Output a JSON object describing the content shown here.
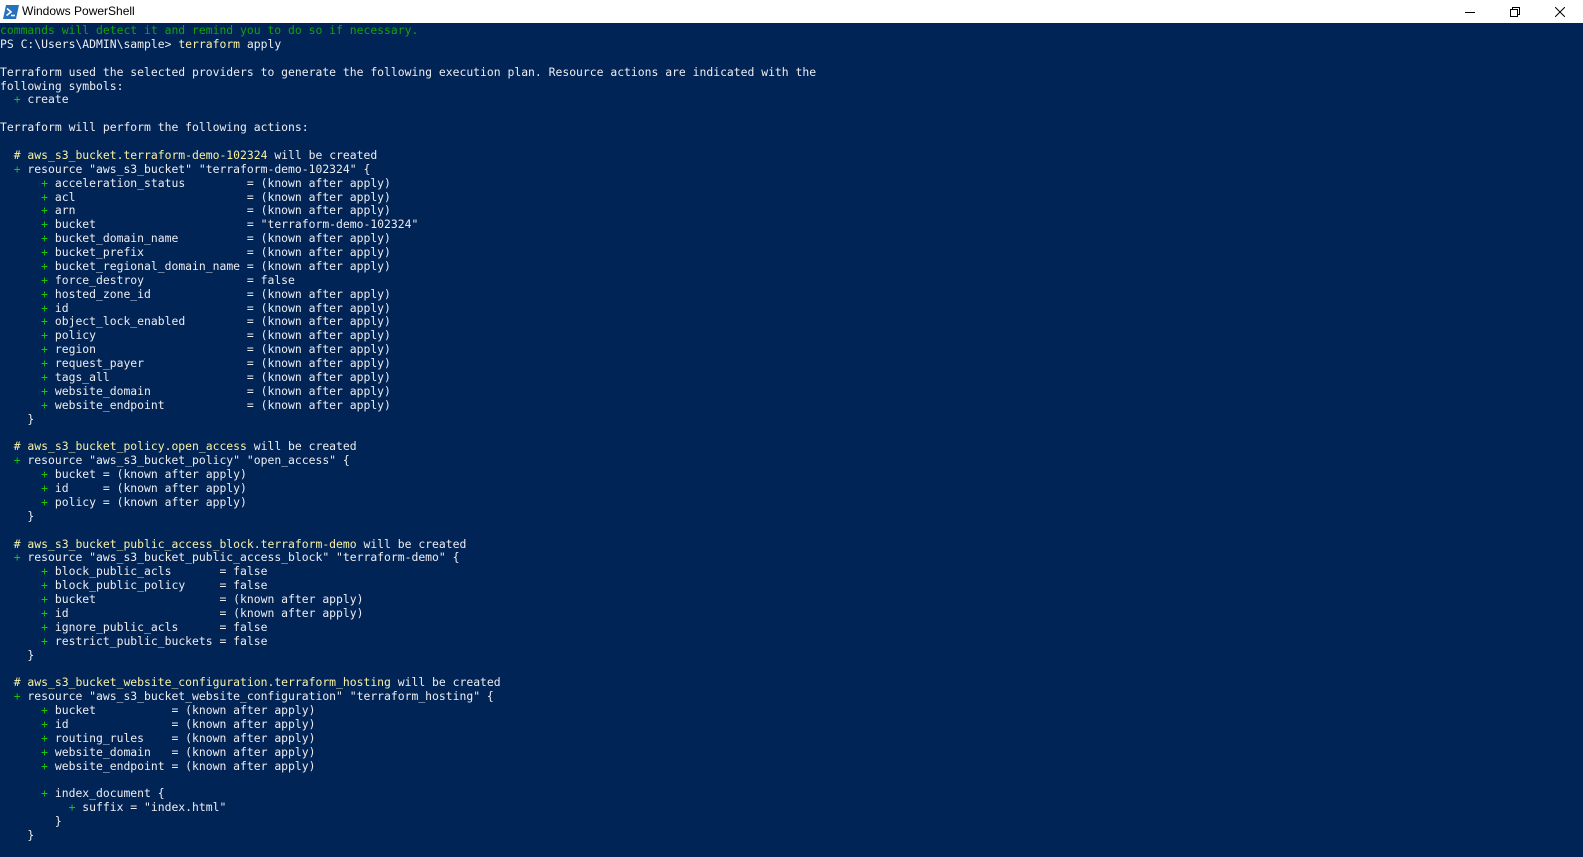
{
  "window": {
    "title": "Windows PowerShell",
    "icon": "powershell-icon",
    "controls": [
      "minimize-icon",
      "restore-icon",
      "close-icon"
    ]
  },
  "colors": {
    "background": "#012456",
    "text": "#eeedf0",
    "command": "#f9f1a5",
    "resource_header": "#f9f1a5",
    "plus": "#16c60c",
    "faded": "#13a10e"
  },
  "console": {
    "lines": [
      {
        "segments": [
          {
            "t": "commands will detect it and remind you to do so if necessary.",
            "c": "dim"
          }
        ]
      },
      {
        "segments": [
          {
            "t": "PS C:\\Users\\ADMIN\\sample> "
          },
          {
            "t": "terraform",
            "c": "yel"
          },
          {
            "t": " apply"
          }
        ]
      },
      {
        "segments": []
      },
      {
        "segments": [
          {
            "t": "Terraform used the selected providers to generate the following execution plan. Resource actions are indicated with the"
          }
        ]
      },
      {
        "segments": [
          {
            "t": "following symbols:"
          }
        ]
      },
      {
        "segments": [
          {
            "t": "  "
          },
          {
            "t": "+",
            "c": "grn"
          },
          {
            "t": " create"
          }
        ]
      },
      {
        "segments": []
      },
      {
        "segments": [
          {
            "t": "Terraform will perform the following actions:"
          }
        ]
      },
      {
        "segments": []
      },
      {
        "segments": [
          {
            "t": "  "
          },
          {
            "t": "# aws_s3_bucket.terraform-demo-102324",
            "c": "yel"
          },
          {
            "t": " will be created"
          }
        ]
      },
      {
        "segments": [
          {
            "t": "  "
          },
          {
            "t": "+",
            "c": "grn"
          },
          {
            "t": " resource \"aws_s3_bucket\" \"terraform-demo-102324\" {"
          }
        ]
      },
      {
        "segments": [
          {
            "t": "      "
          },
          {
            "t": "+",
            "c": "grn"
          },
          {
            "t": " acceleration_status         = (known after apply)"
          }
        ]
      },
      {
        "segments": [
          {
            "t": "      "
          },
          {
            "t": "+",
            "c": "grn"
          },
          {
            "t": " acl                         = (known after apply)"
          }
        ]
      },
      {
        "segments": [
          {
            "t": "      "
          },
          {
            "t": "+",
            "c": "grn"
          },
          {
            "t": " arn                         = (known after apply)"
          }
        ]
      },
      {
        "segments": [
          {
            "t": "      "
          },
          {
            "t": "+",
            "c": "grn"
          },
          {
            "t": " bucket                      = \"terraform-demo-102324\""
          }
        ]
      },
      {
        "segments": [
          {
            "t": "      "
          },
          {
            "t": "+",
            "c": "grn"
          },
          {
            "t": " bucket_domain_name          = (known after apply)"
          }
        ]
      },
      {
        "segments": [
          {
            "t": "      "
          },
          {
            "t": "+",
            "c": "grn"
          },
          {
            "t": " bucket_prefix               = (known after apply)"
          }
        ]
      },
      {
        "segments": [
          {
            "t": "      "
          },
          {
            "t": "+",
            "c": "grn"
          },
          {
            "t": " bucket_regional_domain_name = (known after apply)"
          }
        ]
      },
      {
        "segments": [
          {
            "t": "      "
          },
          {
            "t": "+",
            "c": "grn"
          },
          {
            "t": " force_destroy               = false"
          }
        ]
      },
      {
        "segments": [
          {
            "t": "      "
          },
          {
            "t": "+",
            "c": "grn"
          },
          {
            "t": " hosted_zone_id              = (known after apply)"
          }
        ]
      },
      {
        "segments": [
          {
            "t": "      "
          },
          {
            "t": "+",
            "c": "grn"
          },
          {
            "t": " id                          = (known after apply)"
          }
        ]
      },
      {
        "segments": [
          {
            "t": "      "
          },
          {
            "t": "+",
            "c": "grn"
          },
          {
            "t": " object_lock_enabled         = (known after apply)"
          }
        ]
      },
      {
        "segments": [
          {
            "t": "      "
          },
          {
            "t": "+",
            "c": "grn"
          },
          {
            "t": " policy                      = (known after apply)"
          }
        ]
      },
      {
        "segments": [
          {
            "t": "      "
          },
          {
            "t": "+",
            "c": "grn"
          },
          {
            "t": " region                      = (known after apply)"
          }
        ]
      },
      {
        "segments": [
          {
            "t": "      "
          },
          {
            "t": "+",
            "c": "grn"
          },
          {
            "t": " request_payer               = (known after apply)"
          }
        ]
      },
      {
        "segments": [
          {
            "t": "      "
          },
          {
            "t": "+",
            "c": "grn"
          },
          {
            "t": " tags_all                    = (known after apply)"
          }
        ]
      },
      {
        "segments": [
          {
            "t": "      "
          },
          {
            "t": "+",
            "c": "grn"
          },
          {
            "t": " website_domain              = (known after apply)"
          }
        ]
      },
      {
        "segments": [
          {
            "t": "      "
          },
          {
            "t": "+",
            "c": "grn"
          },
          {
            "t": " website_endpoint            = (known after apply)"
          }
        ]
      },
      {
        "segments": [
          {
            "t": "    }"
          }
        ]
      },
      {
        "segments": []
      },
      {
        "segments": [
          {
            "t": "  "
          },
          {
            "t": "# aws_s3_bucket_policy.open_access",
            "c": "yel"
          },
          {
            "t": " will be created"
          }
        ]
      },
      {
        "segments": [
          {
            "t": "  "
          },
          {
            "t": "+",
            "c": "grn"
          },
          {
            "t": " resource \"aws_s3_bucket_policy\" \"open_access\" {"
          }
        ]
      },
      {
        "segments": [
          {
            "t": "      "
          },
          {
            "t": "+",
            "c": "grn"
          },
          {
            "t": " bucket = (known after apply)"
          }
        ]
      },
      {
        "segments": [
          {
            "t": "      "
          },
          {
            "t": "+",
            "c": "grn"
          },
          {
            "t": " id     = (known after apply)"
          }
        ]
      },
      {
        "segments": [
          {
            "t": "      "
          },
          {
            "t": "+",
            "c": "grn"
          },
          {
            "t": " policy = (known after apply)"
          }
        ]
      },
      {
        "segments": [
          {
            "t": "    }"
          }
        ]
      },
      {
        "segments": []
      },
      {
        "segments": [
          {
            "t": "  "
          },
          {
            "t": "# aws_s3_bucket_public_access_block.terraform-demo",
            "c": "yel"
          },
          {
            "t": " will be created"
          }
        ]
      },
      {
        "segments": [
          {
            "t": "  "
          },
          {
            "t": "+",
            "c": "grn"
          },
          {
            "t": " resource \"aws_s3_bucket_public_access_block\" \"terraform-demo\" {"
          }
        ]
      },
      {
        "segments": [
          {
            "t": "      "
          },
          {
            "t": "+",
            "c": "grn"
          },
          {
            "t": " block_public_acls       = false"
          }
        ]
      },
      {
        "segments": [
          {
            "t": "      "
          },
          {
            "t": "+",
            "c": "grn"
          },
          {
            "t": " block_public_policy     = false"
          }
        ]
      },
      {
        "segments": [
          {
            "t": "      "
          },
          {
            "t": "+",
            "c": "grn"
          },
          {
            "t": " bucket                  = (known after apply)"
          }
        ]
      },
      {
        "segments": [
          {
            "t": "      "
          },
          {
            "t": "+",
            "c": "grn"
          },
          {
            "t": " id                      = (known after apply)"
          }
        ]
      },
      {
        "segments": [
          {
            "t": "      "
          },
          {
            "t": "+",
            "c": "grn"
          },
          {
            "t": " ignore_public_acls      = false"
          }
        ]
      },
      {
        "segments": [
          {
            "t": "      "
          },
          {
            "t": "+",
            "c": "grn"
          },
          {
            "t": " restrict_public_buckets = false"
          }
        ]
      },
      {
        "segments": [
          {
            "t": "    }"
          }
        ]
      },
      {
        "segments": []
      },
      {
        "segments": [
          {
            "t": "  "
          },
          {
            "t": "# aws_s3_bucket_website_configuration.terraform_hosting",
            "c": "yel"
          },
          {
            "t": " will be created"
          }
        ]
      },
      {
        "segments": [
          {
            "t": "  "
          },
          {
            "t": "+",
            "c": "grn"
          },
          {
            "t": " resource \"aws_s3_bucket_website_configuration\" \"terraform_hosting\" {"
          }
        ]
      },
      {
        "segments": [
          {
            "t": "      "
          },
          {
            "t": "+",
            "c": "grn"
          },
          {
            "t": " bucket           = (known after apply)"
          }
        ]
      },
      {
        "segments": [
          {
            "t": "      "
          },
          {
            "t": "+",
            "c": "grn"
          },
          {
            "t": " id               = (known after apply)"
          }
        ]
      },
      {
        "segments": [
          {
            "t": "      "
          },
          {
            "t": "+",
            "c": "grn"
          },
          {
            "t": " routing_rules    = (known after apply)"
          }
        ]
      },
      {
        "segments": [
          {
            "t": "      "
          },
          {
            "t": "+",
            "c": "grn"
          },
          {
            "t": " website_domain   = (known after apply)"
          }
        ]
      },
      {
        "segments": [
          {
            "t": "      "
          },
          {
            "t": "+",
            "c": "grn"
          },
          {
            "t": " website_endpoint = (known after apply)"
          }
        ]
      },
      {
        "segments": []
      },
      {
        "segments": [
          {
            "t": "      "
          },
          {
            "t": "+",
            "c": "grn"
          },
          {
            "t": " index_document {"
          }
        ]
      },
      {
        "segments": [
          {
            "t": "          "
          },
          {
            "t": "+",
            "c": "grn"
          },
          {
            "t": " suffix = \"index.html\""
          }
        ]
      },
      {
        "segments": [
          {
            "t": "        }"
          }
        ]
      },
      {
        "segments": [
          {
            "t": "    }"
          }
        ]
      }
    ]
  }
}
